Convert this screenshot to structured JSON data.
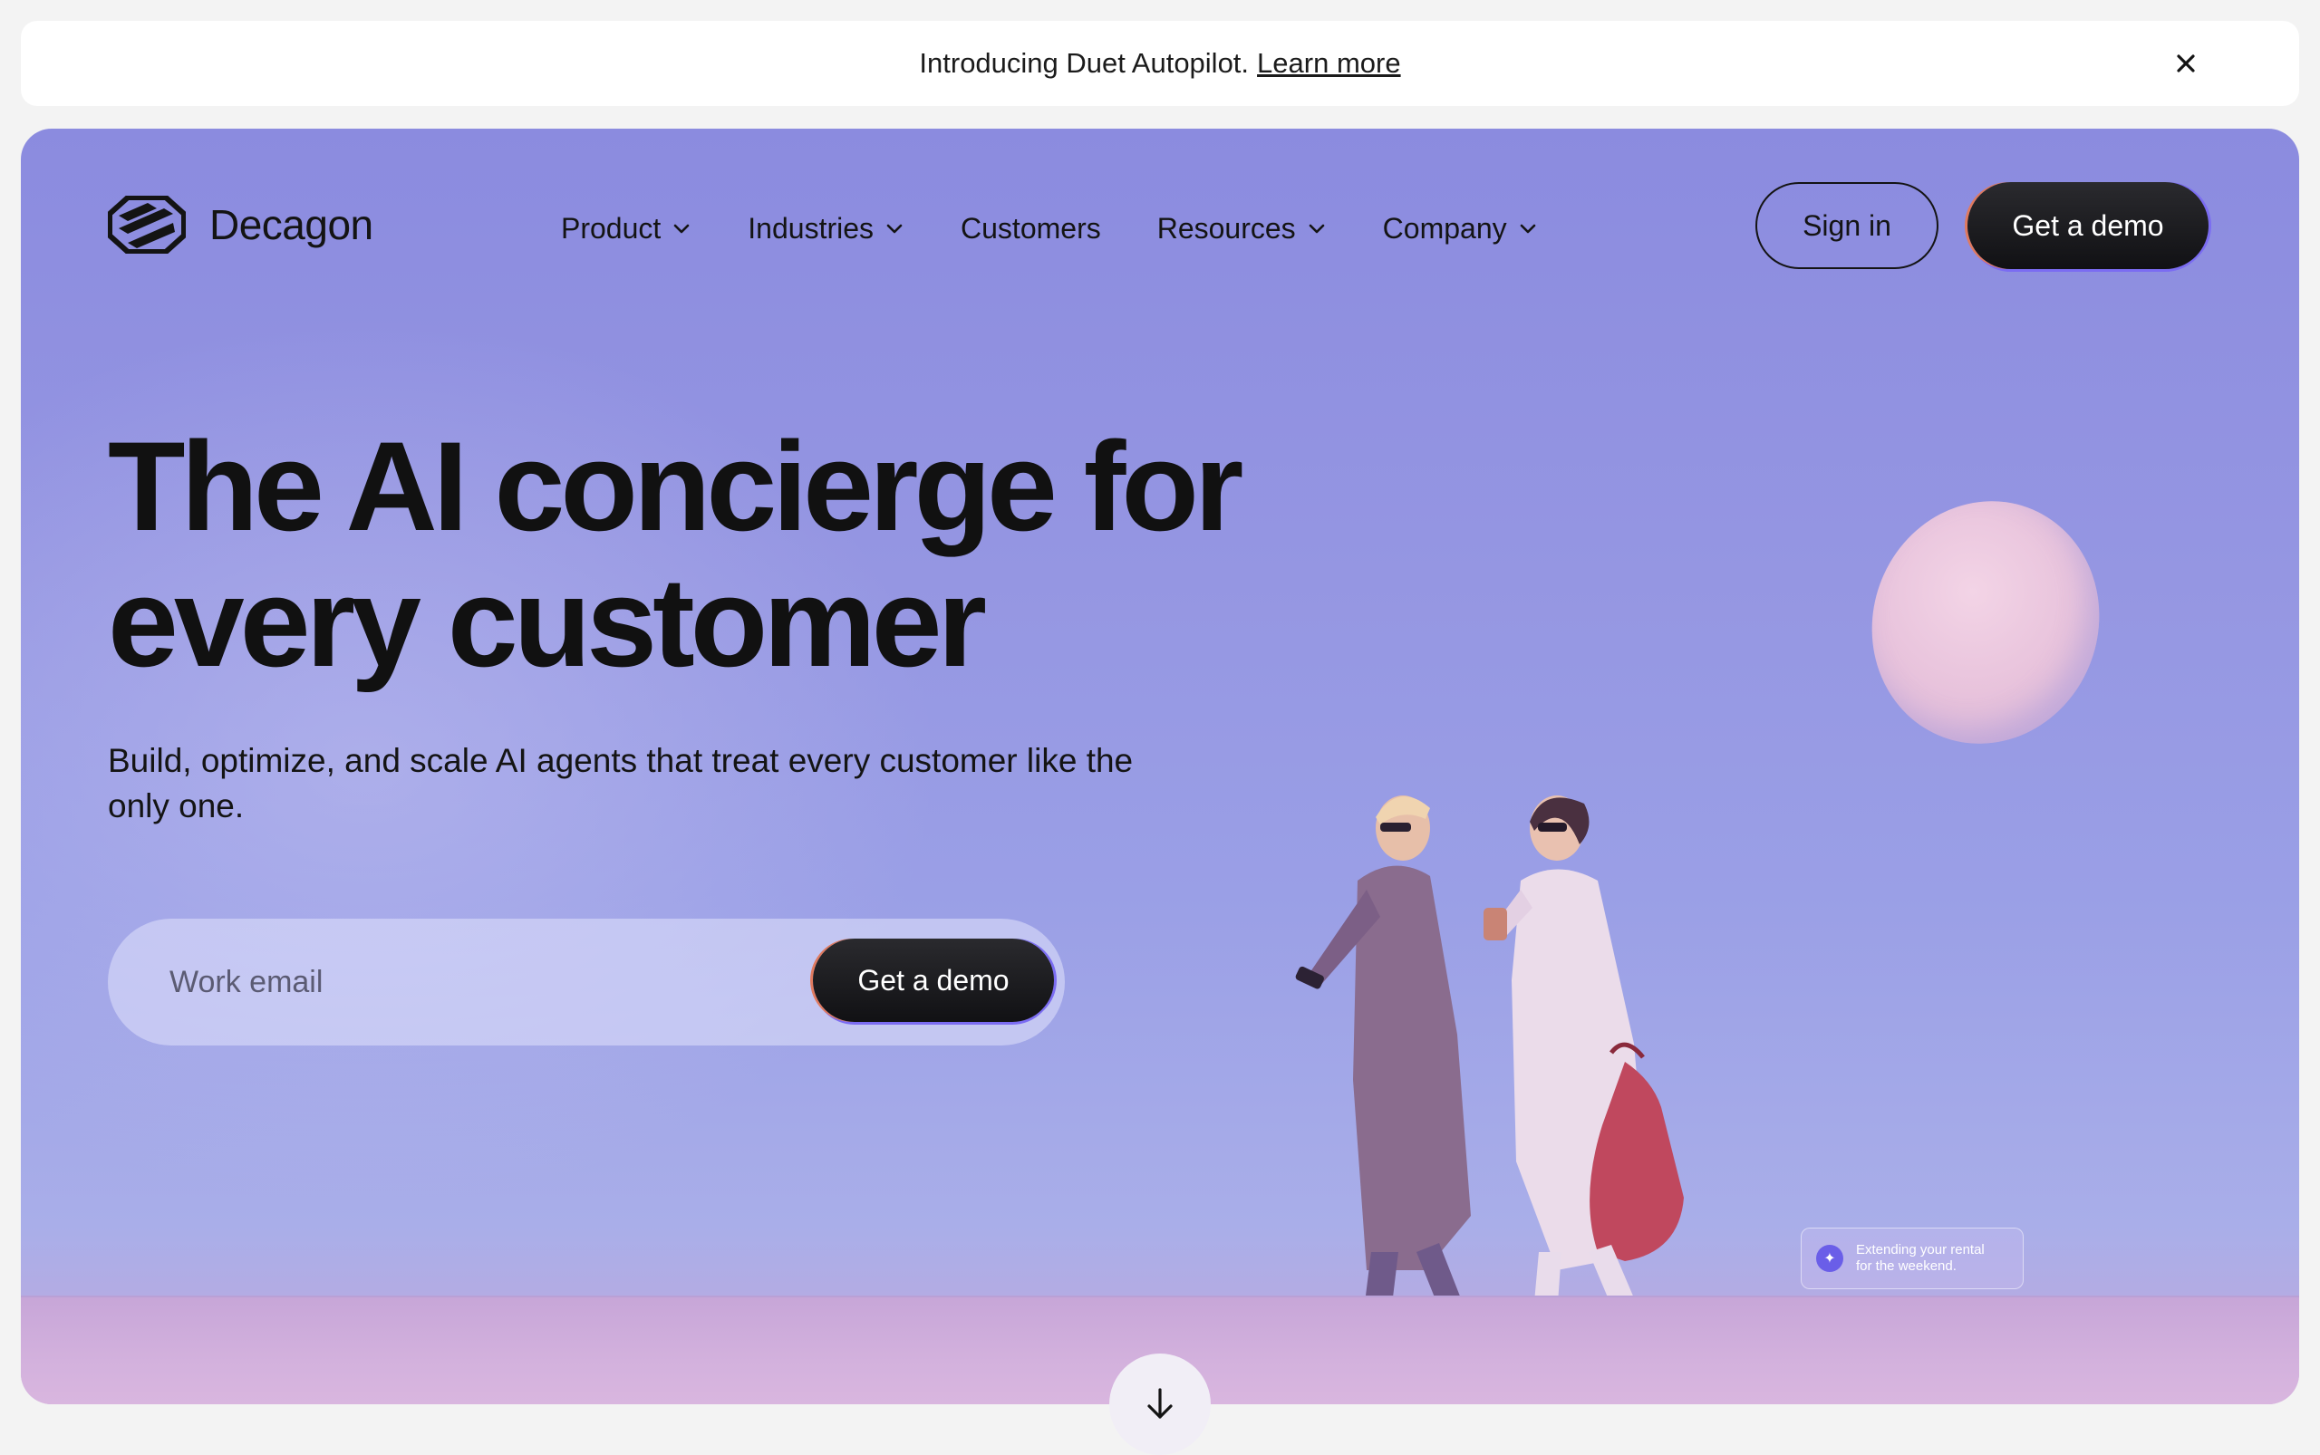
{
  "announcement": {
    "text": "Introducing Duet Autopilot.",
    "link": "Learn more",
    "close_icon": "close-icon"
  },
  "nav": {
    "brand": "Decagon",
    "logo_icon": "decagon-logo-icon",
    "items": [
      {
        "label": "Product",
        "has_dropdown": true
      },
      {
        "label": "Industries",
        "has_dropdown": true
      },
      {
        "label": "Customers",
        "has_dropdown": false
      },
      {
        "label": "Resources",
        "has_dropdown": true
      },
      {
        "label": "Company",
        "has_dropdown": true
      }
    ],
    "sign_in": "Sign in",
    "get_demo": "Get a demo"
  },
  "hero": {
    "headline_line1": "The AI concierge for",
    "headline_line2": "every customer",
    "subhead": "Build, optimize, and scale AI agents that treat every customer like the only one.",
    "email_placeholder": "Work email",
    "cta": "Get a demo",
    "chat_chip_line1": "Extending your rental",
    "chat_chip_line2": "for the weekend.",
    "scroll_icon": "arrow-down-icon"
  },
  "colors": {
    "sky": "#8b8bdf",
    "ground": "#d3b1dd",
    "cta_bg": "#141416",
    "accent_orange": "#e07a5f",
    "accent_violet": "#7b6cf2"
  }
}
